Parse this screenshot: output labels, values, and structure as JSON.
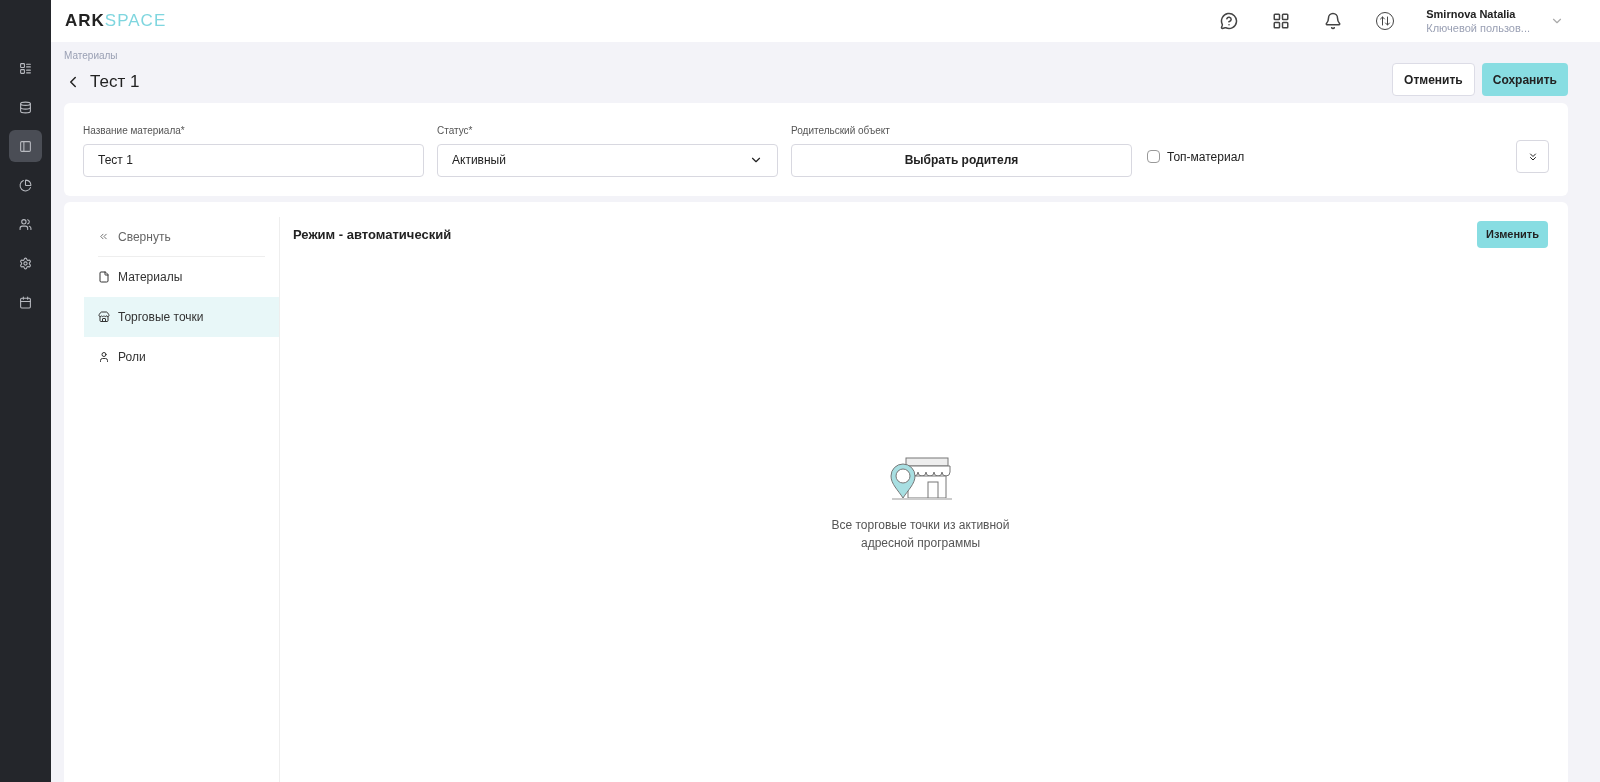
{
  "rail": [
    {
      "selected": false
    },
    {
      "selected": false
    },
    {
      "selected": true
    },
    {
      "selected": false
    },
    {
      "selected": false
    },
    {
      "selected": false
    },
    {
      "selected": false
    }
  ],
  "logo": {
    "dark_part": "ARK",
    "light_part": "SPACE"
  },
  "user": {
    "name": "Smirnova Natalia",
    "role": "Ключевой пользов..."
  },
  "breadcrumb": "Материалы",
  "title": "Тест 1",
  "actions": {
    "cancel": "Отменить",
    "save": "Сохранить"
  },
  "form": {
    "name_label": "Название материала*",
    "name_value": "Тест 1",
    "status_label": "Статус*",
    "status_value": "Активный",
    "parent_label": "Родительский объект",
    "parent_button": "Выбрать родителя",
    "top_material": {
      "label": "Топ-материал",
      "checked": false
    }
  },
  "nav": {
    "collapse": "Свернуть",
    "items": [
      {
        "label": "Материалы",
        "selected": false
      },
      {
        "label": "Торговые точки",
        "selected": true
      },
      {
        "label": "Роли",
        "selected": false
      }
    ]
  },
  "mode": {
    "title": "Режим - автоматический",
    "button": "Изменить"
  },
  "empty": {
    "text": "Все торговые точки из активной адресной программы"
  }
}
